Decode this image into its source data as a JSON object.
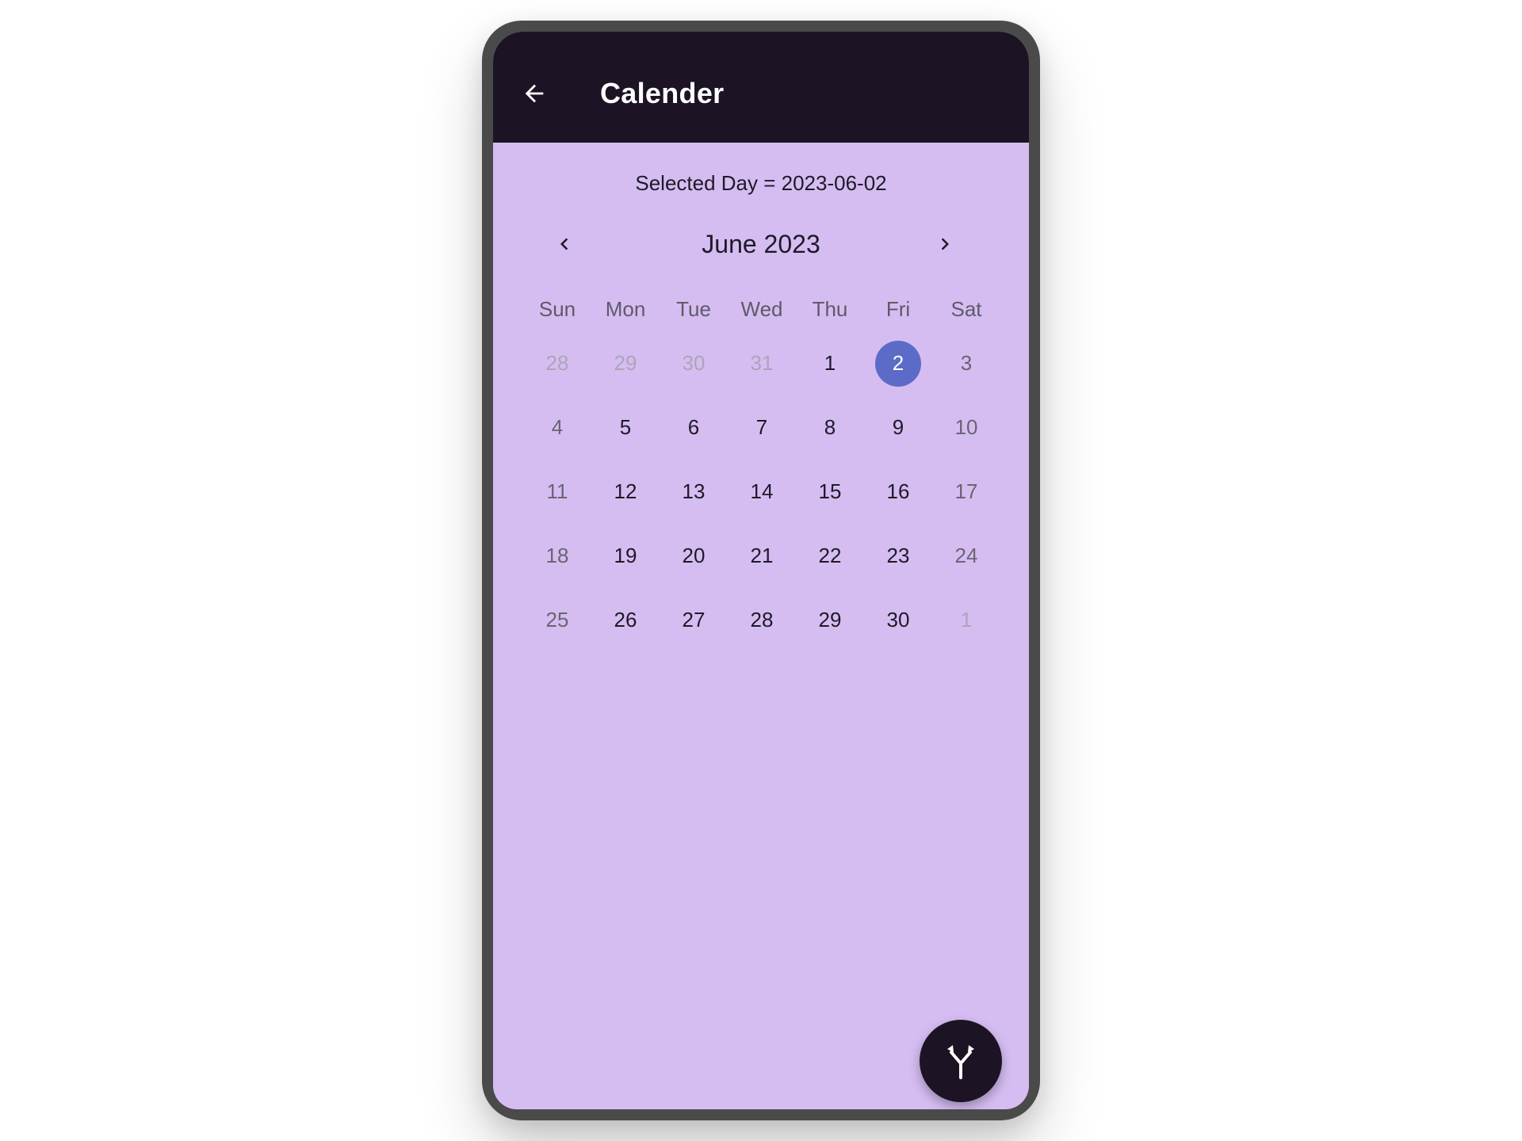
{
  "app": {
    "title": "Calender",
    "back_icon": "arrow-left-icon"
  },
  "calendar": {
    "selected_day_text": "Selected Day = 2023-06-02",
    "month_title": "June 2023",
    "prev_icon": "chevron-left-icon",
    "next_icon": "chevron-right-icon",
    "weekdays": [
      "Sun",
      "Mon",
      "Tue",
      "Wed",
      "Thu",
      "Fri",
      "Sat"
    ],
    "days": [
      {
        "label": "28",
        "outside": true
      },
      {
        "label": "29",
        "outside": true
      },
      {
        "label": "30",
        "outside": true
      },
      {
        "label": "31",
        "outside": true
      },
      {
        "label": "1",
        "outside": false
      },
      {
        "label": "2",
        "outside": false,
        "selected": true
      },
      {
        "label": "3",
        "outside": false
      },
      {
        "label": "4",
        "outside": false
      },
      {
        "label": "5",
        "outside": false
      },
      {
        "label": "6",
        "outside": false
      },
      {
        "label": "7",
        "outside": false
      },
      {
        "label": "8",
        "outside": false
      },
      {
        "label": "9",
        "outside": false
      },
      {
        "label": "10",
        "outside": false
      },
      {
        "label": "11",
        "outside": false
      },
      {
        "label": "12",
        "outside": false
      },
      {
        "label": "13",
        "outside": false
      },
      {
        "label": "14",
        "outside": false
      },
      {
        "label": "15",
        "outside": false
      },
      {
        "label": "16",
        "outside": false
      },
      {
        "label": "17",
        "outside": false
      },
      {
        "label": "18",
        "outside": false
      },
      {
        "label": "19",
        "outside": false
      },
      {
        "label": "20",
        "outside": false
      },
      {
        "label": "21",
        "outside": false
      },
      {
        "label": "22",
        "outside": false
      },
      {
        "label": "23",
        "outside": false
      },
      {
        "label": "24",
        "outside": false
      },
      {
        "label": "25",
        "outside": false
      },
      {
        "label": "26",
        "outside": false
      },
      {
        "label": "27",
        "outside": false
      },
      {
        "label": "28",
        "outside": false
      },
      {
        "label": "29",
        "outside": false
      },
      {
        "label": "30",
        "outside": false
      },
      {
        "label": "1",
        "outside": true
      }
    ]
  },
  "fab": {
    "icon": "merge-arrows-icon"
  },
  "colors": {
    "app_bar": "#1c1424",
    "background": "#d5bdf2",
    "selected_day": "#5c6bc8",
    "fab": "#1c1424"
  }
}
